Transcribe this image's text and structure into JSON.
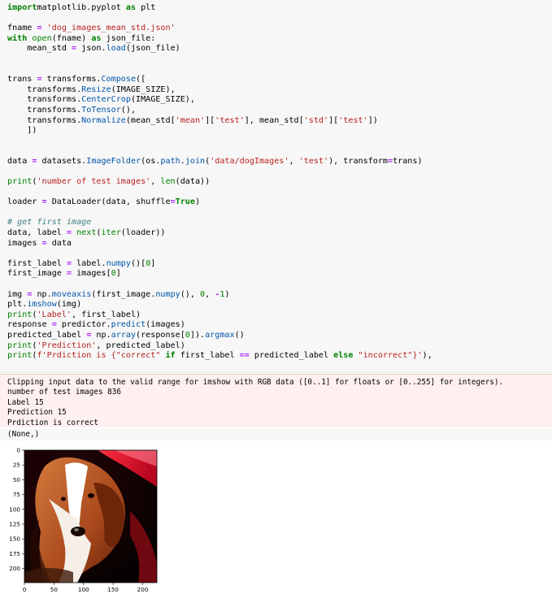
{
  "code_lines": [
    [
      [
        "kw",
        "import"
      ],
      [
        "",
        "matplotlib.pyplot "
      ],
      [
        "kw",
        "as"
      ],
      [
        "",
        " plt"
      ]
    ],
    [],
    [
      [
        "",
        "fname "
      ],
      [
        "op",
        "="
      ],
      [
        "",
        " "
      ],
      [
        "st",
        "'dog_images_mean_std.json'"
      ]
    ],
    [
      [
        "kw",
        "with"
      ],
      [
        "",
        " "
      ],
      [
        "bi",
        "open"
      ],
      [
        "",
        "(fname) "
      ],
      [
        "kw",
        "as"
      ],
      [
        "",
        " json_file:"
      ]
    ],
    [
      [
        "",
        "    mean_std "
      ],
      [
        "op",
        "="
      ],
      [
        "",
        " json."
      ],
      [
        "at",
        "load"
      ],
      [
        "",
        "(json_file)"
      ]
    ],
    [],
    [],
    [
      [
        "",
        "trans "
      ],
      [
        "op",
        "="
      ],
      [
        "",
        " transforms."
      ],
      [
        "at",
        "Compose"
      ],
      [
        "",
        "(["
      ]
    ],
    [
      [
        "",
        "    transforms."
      ],
      [
        "at",
        "Resize"
      ],
      [
        "",
        "(IMAGE_SIZE),"
      ]
    ],
    [
      [
        "",
        "    transforms."
      ],
      [
        "at",
        "CenterCrop"
      ],
      [
        "",
        "(IMAGE_SIZE),"
      ]
    ],
    [
      [
        "",
        "    transforms."
      ],
      [
        "at",
        "ToTensor"
      ],
      [
        "",
        "(),"
      ]
    ],
    [
      [
        "",
        "    transforms."
      ],
      [
        "at",
        "Normalize"
      ],
      [
        "",
        "(mean_std["
      ],
      [
        "st",
        "'mean'"
      ],
      [
        "",
        "]["
      ],
      [
        "st",
        "'test'"
      ],
      [
        "",
        "], mean_std["
      ],
      [
        "st",
        "'std'"
      ],
      [
        "",
        "]["
      ],
      [
        "st",
        "'test'"
      ],
      [
        "",
        "])"
      ]
    ],
    [
      [
        "",
        "    ])"
      ]
    ],
    [],
    [],
    [
      [
        "",
        "data "
      ],
      [
        "op",
        "="
      ],
      [
        "",
        " datasets."
      ],
      [
        "at",
        "ImageFolder"
      ],
      [
        "",
        "(os."
      ],
      [
        "at",
        "path"
      ],
      [
        "",
        "."
      ],
      [
        "at",
        "join"
      ],
      [
        "",
        "("
      ],
      [
        "st",
        "'data/dogImages'"
      ],
      [
        "",
        ", "
      ],
      [
        "st",
        "'test'"
      ],
      [
        "",
        "), transform"
      ],
      [
        "op",
        "="
      ],
      [
        "",
        "trans)"
      ]
    ],
    [],
    [
      [
        "bi",
        "print"
      ],
      [
        "",
        "("
      ],
      [
        "st",
        "'number of test images'"
      ],
      [
        "",
        ", "
      ],
      [
        "bi",
        "len"
      ],
      [
        "",
        "(data))"
      ]
    ],
    [],
    [
      [
        "",
        "loader "
      ],
      [
        "op",
        "="
      ],
      [
        "",
        " DataLoader(data, shuffle"
      ],
      [
        "op",
        "="
      ],
      [
        "kw",
        "True"
      ],
      [
        "",
        ")"
      ]
    ],
    [],
    [
      [
        "cm",
        "# get first image"
      ]
    ],
    [
      [
        "",
        "data, label "
      ],
      [
        "op",
        "="
      ],
      [
        "",
        " "
      ],
      [
        "bi",
        "next"
      ],
      [
        "",
        "("
      ],
      [
        "bi",
        "iter"
      ],
      [
        "",
        "(loader))"
      ]
    ],
    [
      [
        "",
        "images "
      ],
      [
        "op",
        "="
      ],
      [
        "",
        " data"
      ]
    ],
    [],
    [
      [
        "",
        "first_label "
      ],
      [
        "op",
        "="
      ],
      [
        "",
        " label."
      ],
      [
        "at",
        "numpy"
      ],
      [
        "",
        "()["
      ],
      [
        "nb",
        "0"
      ],
      [
        "",
        "]"
      ]
    ],
    [
      [
        "",
        "first_image "
      ],
      [
        "op",
        "="
      ],
      [
        "",
        " images["
      ],
      [
        "nb",
        "0"
      ],
      [
        "",
        "]"
      ]
    ],
    [],
    [
      [
        "",
        "img "
      ],
      [
        "op",
        "="
      ],
      [
        "",
        " np."
      ],
      [
        "at",
        "moveaxis"
      ],
      [
        "",
        "(first_image."
      ],
      [
        "at",
        "numpy"
      ],
      [
        "",
        "(), "
      ],
      [
        "nb",
        "0"
      ],
      [
        "",
        ", "
      ],
      [
        "op",
        "-"
      ],
      [
        "nb",
        "1"
      ],
      [
        "",
        ")"
      ]
    ],
    [
      [
        "",
        "plt."
      ],
      [
        "at",
        "imshow"
      ],
      [
        "",
        "(img)"
      ]
    ],
    [
      [
        "bi",
        "print"
      ],
      [
        "",
        "("
      ],
      [
        "st",
        "'Label'"
      ],
      [
        "",
        ", first_label)"
      ]
    ],
    [
      [
        "",
        "response "
      ],
      [
        "op",
        "="
      ],
      [
        "",
        " predictor."
      ],
      [
        "at",
        "predict"
      ],
      [
        "",
        "(images)"
      ]
    ],
    [
      [
        "",
        "predicted_label "
      ],
      [
        "op",
        "="
      ],
      [
        "",
        " np."
      ],
      [
        "at",
        "array"
      ],
      [
        "",
        "(response["
      ],
      [
        "nb",
        "0"
      ],
      [
        "",
        "])."
      ],
      [
        "at",
        "argmax"
      ],
      [
        "",
        "()"
      ]
    ],
    [
      [
        "bi",
        "print"
      ],
      [
        "",
        "("
      ],
      [
        "st",
        "'Prediction'"
      ],
      [
        "",
        ", predicted_label)"
      ]
    ],
    [
      [
        "bi",
        "print"
      ],
      [
        "",
        "("
      ],
      [
        "st",
        "f'Prdiction is {"
      ],
      [
        "st",
        "\"correct\""
      ],
      [
        "",
        " "
      ],
      [
        "kw",
        "if"
      ],
      [
        "",
        " first_label "
      ],
      [
        "op",
        "=="
      ],
      [
        "",
        " predicted_label "
      ],
      [
        "kw",
        "else"
      ],
      [
        "",
        " "
      ],
      [
        "st",
        "\"incorrect\""
      ],
      [
        "st",
        "}'"
      ],
      [
        "",
        "),"
      ]
    ]
  ],
  "stderr_lines": [
    "Clipping input data to the valid range for imshow with RGB data ([0..1] for floats or [0..255] for integers).",
    "number of test images 836",
    "Label 15",
    "Prediction 15",
    "Prdiction is correct"
  ],
  "exec_result": "(None,)",
  "plot": {
    "y_ticks": [
      "0",
      "25",
      "50",
      "75",
      "100",
      "125",
      "150",
      "175",
      "200"
    ],
    "x_ticks": [
      "0",
      "50",
      "100",
      "150",
      "200"
    ],
    "image_subject": "dog-portrait"
  }
}
